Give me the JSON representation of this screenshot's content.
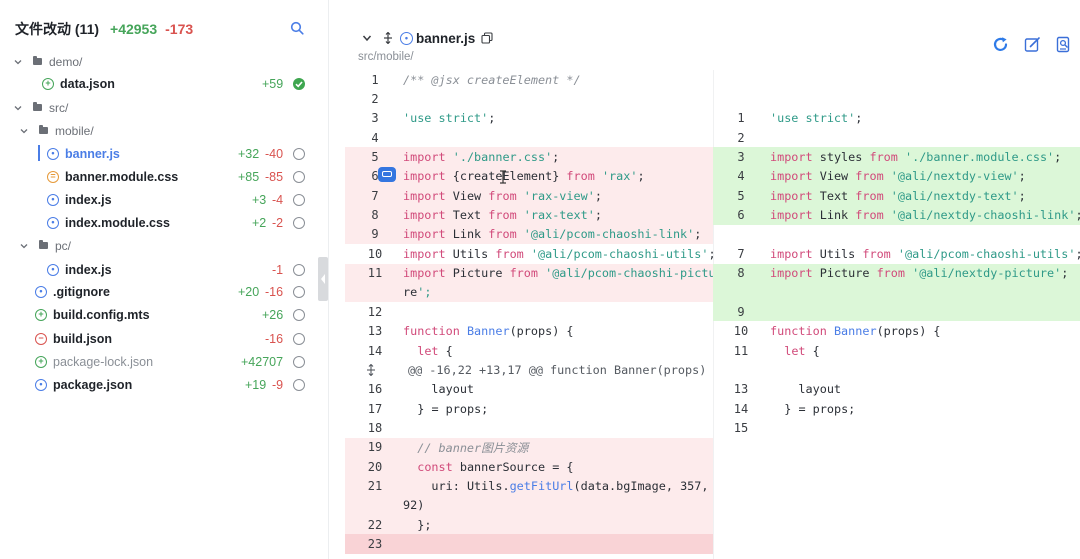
{
  "left_panel": {
    "title": "文件改动 (11)",
    "total_added": "+42953",
    "total_removed": "-173",
    "tree": [
      {
        "type": "folder",
        "name": "demo/",
        "depth": 0
      },
      {
        "type": "file",
        "name": "data.json",
        "status": "added",
        "added": "+59",
        "removed": "",
        "checked": true,
        "depth": 1
      },
      {
        "type": "folder",
        "name": "src/",
        "depth": 0
      },
      {
        "type": "folder",
        "name": "mobile/",
        "depth": 1
      },
      {
        "type": "file",
        "name": "banner.js",
        "status": "modified",
        "added": "+32",
        "removed": "-40",
        "checked": false,
        "active": true,
        "depth": 2
      },
      {
        "type": "file",
        "name": "banner.module.css",
        "status": "renamed",
        "added": "+85",
        "removed": "-85",
        "checked": false,
        "depth": 2
      },
      {
        "type": "file",
        "name": "index.js",
        "status": "modified",
        "added": "+3",
        "removed": "-4",
        "checked": false,
        "depth": 2
      },
      {
        "type": "file",
        "name": "index.module.css",
        "status": "modified",
        "added": "+2",
        "removed": "-2",
        "checked": false,
        "depth": 2
      },
      {
        "type": "folder",
        "name": "pc/",
        "depth": 1
      },
      {
        "type": "file",
        "name": "index.js",
        "status": "modified",
        "added": "",
        "removed": "-1",
        "checked": false,
        "depth": 2
      },
      {
        "type": "file",
        "name": ".gitignore",
        "status": "modified",
        "added": "+20",
        "removed": "-16",
        "checked": false,
        "depth": 0
      },
      {
        "type": "file",
        "name": "build.config.mts",
        "status": "added",
        "added": "+26",
        "removed": "",
        "checked": false,
        "depth": 0
      },
      {
        "type": "file",
        "name": "build.json",
        "status": "deleted",
        "added": "",
        "removed": "-16",
        "checked": false,
        "depth": 0
      },
      {
        "type": "file",
        "name": "package-lock.json",
        "status": "added",
        "added": "+42707",
        "removed": "",
        "checked": false,
        "muted": true,
        "depth": 0
      },
      {
        "type": "file",
        "name": "package.json",
        "status": "modified",
        "added": "+19",
        "removed": "-9",
        "checked": false,
        "depth": 0
      }
    ]
  },
  "file_header": {
    "name": "banner.js",
    "path": "src/mobile/"
  },
  "diff": {
    "left": [
      {
        "ln": "1",
        "code": "/** @jsx createElement */",
        "kind": "comment"
      },
      {
        "ln": "2",
        "code": ""
      },
      {
        "ln": "3",
        "code": "'use strict';",
        "kind": "string"
      },
      {
        "ln": "4",
        "code": ""
      },
      {
        "ln": "5",
        "code": "import './banner.css';",
        "bg": "del"
      },
      {
        "ln": "6",
        "code": "import {createElement} from 'rax';",
        "bg": "del"
      },
      {
        "ln": "7",
        "code": "import View from 'rax-view';",
        "bg": "del"
      },
      {
        "ln": "8",
        "code": "import Text from 'rax-text';",
        "bg": "del"
      },
      {
        "ln": "9",
        "code": "import Link from '@ali/pcom-chaoshi-link';",
        "bg": "del"
      },
      {
        "ln": "10",
        "code": "import Utils from '@ali/pcom-chaoshi-utils';"
      },
      {
        "ln": "11",
        "code": "import Picture from '@ali/pcom-chaoshi-pictu",
        "bg": "del"
      },
      {
        "ln": "",
        "code": "re';",
        "bg": "del"
      },
      {
        "ln": "12",
        "code": ""
      },
      {
        "ln": "13",
        "code": "function Banner(props) {"
      },
      {
        "ln": "14",
        "code": "  let {"
      },
      {
        "ln": "",
        "code": "@@ -16,22 +13,17 @@ function Banner(props) {",
        "kind": "hunk"
      },
      {
        "ln": "16",
        "code": "    layout"
      },
      {
        "ln": "17",
        "code": "  } = props;"
      },
      {
        "ln": "18",
        "code": ""
      },
      {
        "ln": "19",
        "code": "  // banner图片资源",
        "bg": "del",
        "kind": "comment"
      },
      {
        "ln": "20",
        "code": "  const bannerSource = {",
        "bg": "del"
      },
      {
        "ln": "21",
        "code": "    uri: Utils.getFitUrl(data.bgImage, 357,",
        "bg": "del"
      },
      {
        "ln": "",
        "code": "92)",
        "bg": "del"
      },
      {
        "ln": "22",
        "code": "  };",
        "bg": "del"
      },
      {
        "ln": "23",
        "code": "",
        "bg": "del-strong"
      }
    ],
    "right": [
      {
        "ln": "",
        "code": ""
      },
      {
        "ln": "",
        "code": ""
      },
      {
        "ln": "1",
        "code": "'use strict';"
      },
      {
        "ln": "2",
        "code": ""
      },
      {
        "ln": "3",
        "code": "import styles from './banner.module.css';",
        "bg": "add"
      },
      {
        "ln": "4",
        "code": "import View from '@ali/nextdy-view';",
        "bg": "add"
      },
      {
        "ln": "5",
        "code": "import Text from '@ali/nextdy-text';",
        "bg": "add"
      },
      {
        "ln": "6",
        "code": "import Link from '@ali/nextdy-chaoshi-link';",
        "bg": "add"
      },
      {
        "ln": "",
        "code": ""
      },
      {
        "ln": "7",
        "code": "import Utils from '@ali/pcom-chaoshi-utils';"
      },
      {
        "ln": "8",
        "code": "import Picture from '@ali/nextdy-picture';",
        "bg": "add"
      },
      {
        "ln": "",
        "code": "",
        "bg": "add"
      },
      {
        "ln": "9",
        "code": "",
        "bg": "add"
      },
      {
        "ln": "10",
        "code": "function Banner(props) {"
      },
      {
        "ln": "11",
        "code": "  let {"
      },
      {
        "ln": "",
        "code": ""
      },
      {
        "ln": "13",
        "code": "    layout"
      },
      {
        "ln": "14",
        "code": "  } = props;"
      },
      {
        "ln": "15",
        "code": ""
      }
    ]
  },
  "colors": {
    "added": "#46a55a",
    "removed": "#d9534f",
    "accent": "#4a7de6",
    "del_bg": "#fdebec",
    "add_bg": "#dcf7d8"
  },
  "icons": {
    "search": "search-icon",
    "refresh": "refresh-icon",
    "edit": "edit-icon",
    "review": "review-icon",
    "comment": "comment-icon"
  }
}
